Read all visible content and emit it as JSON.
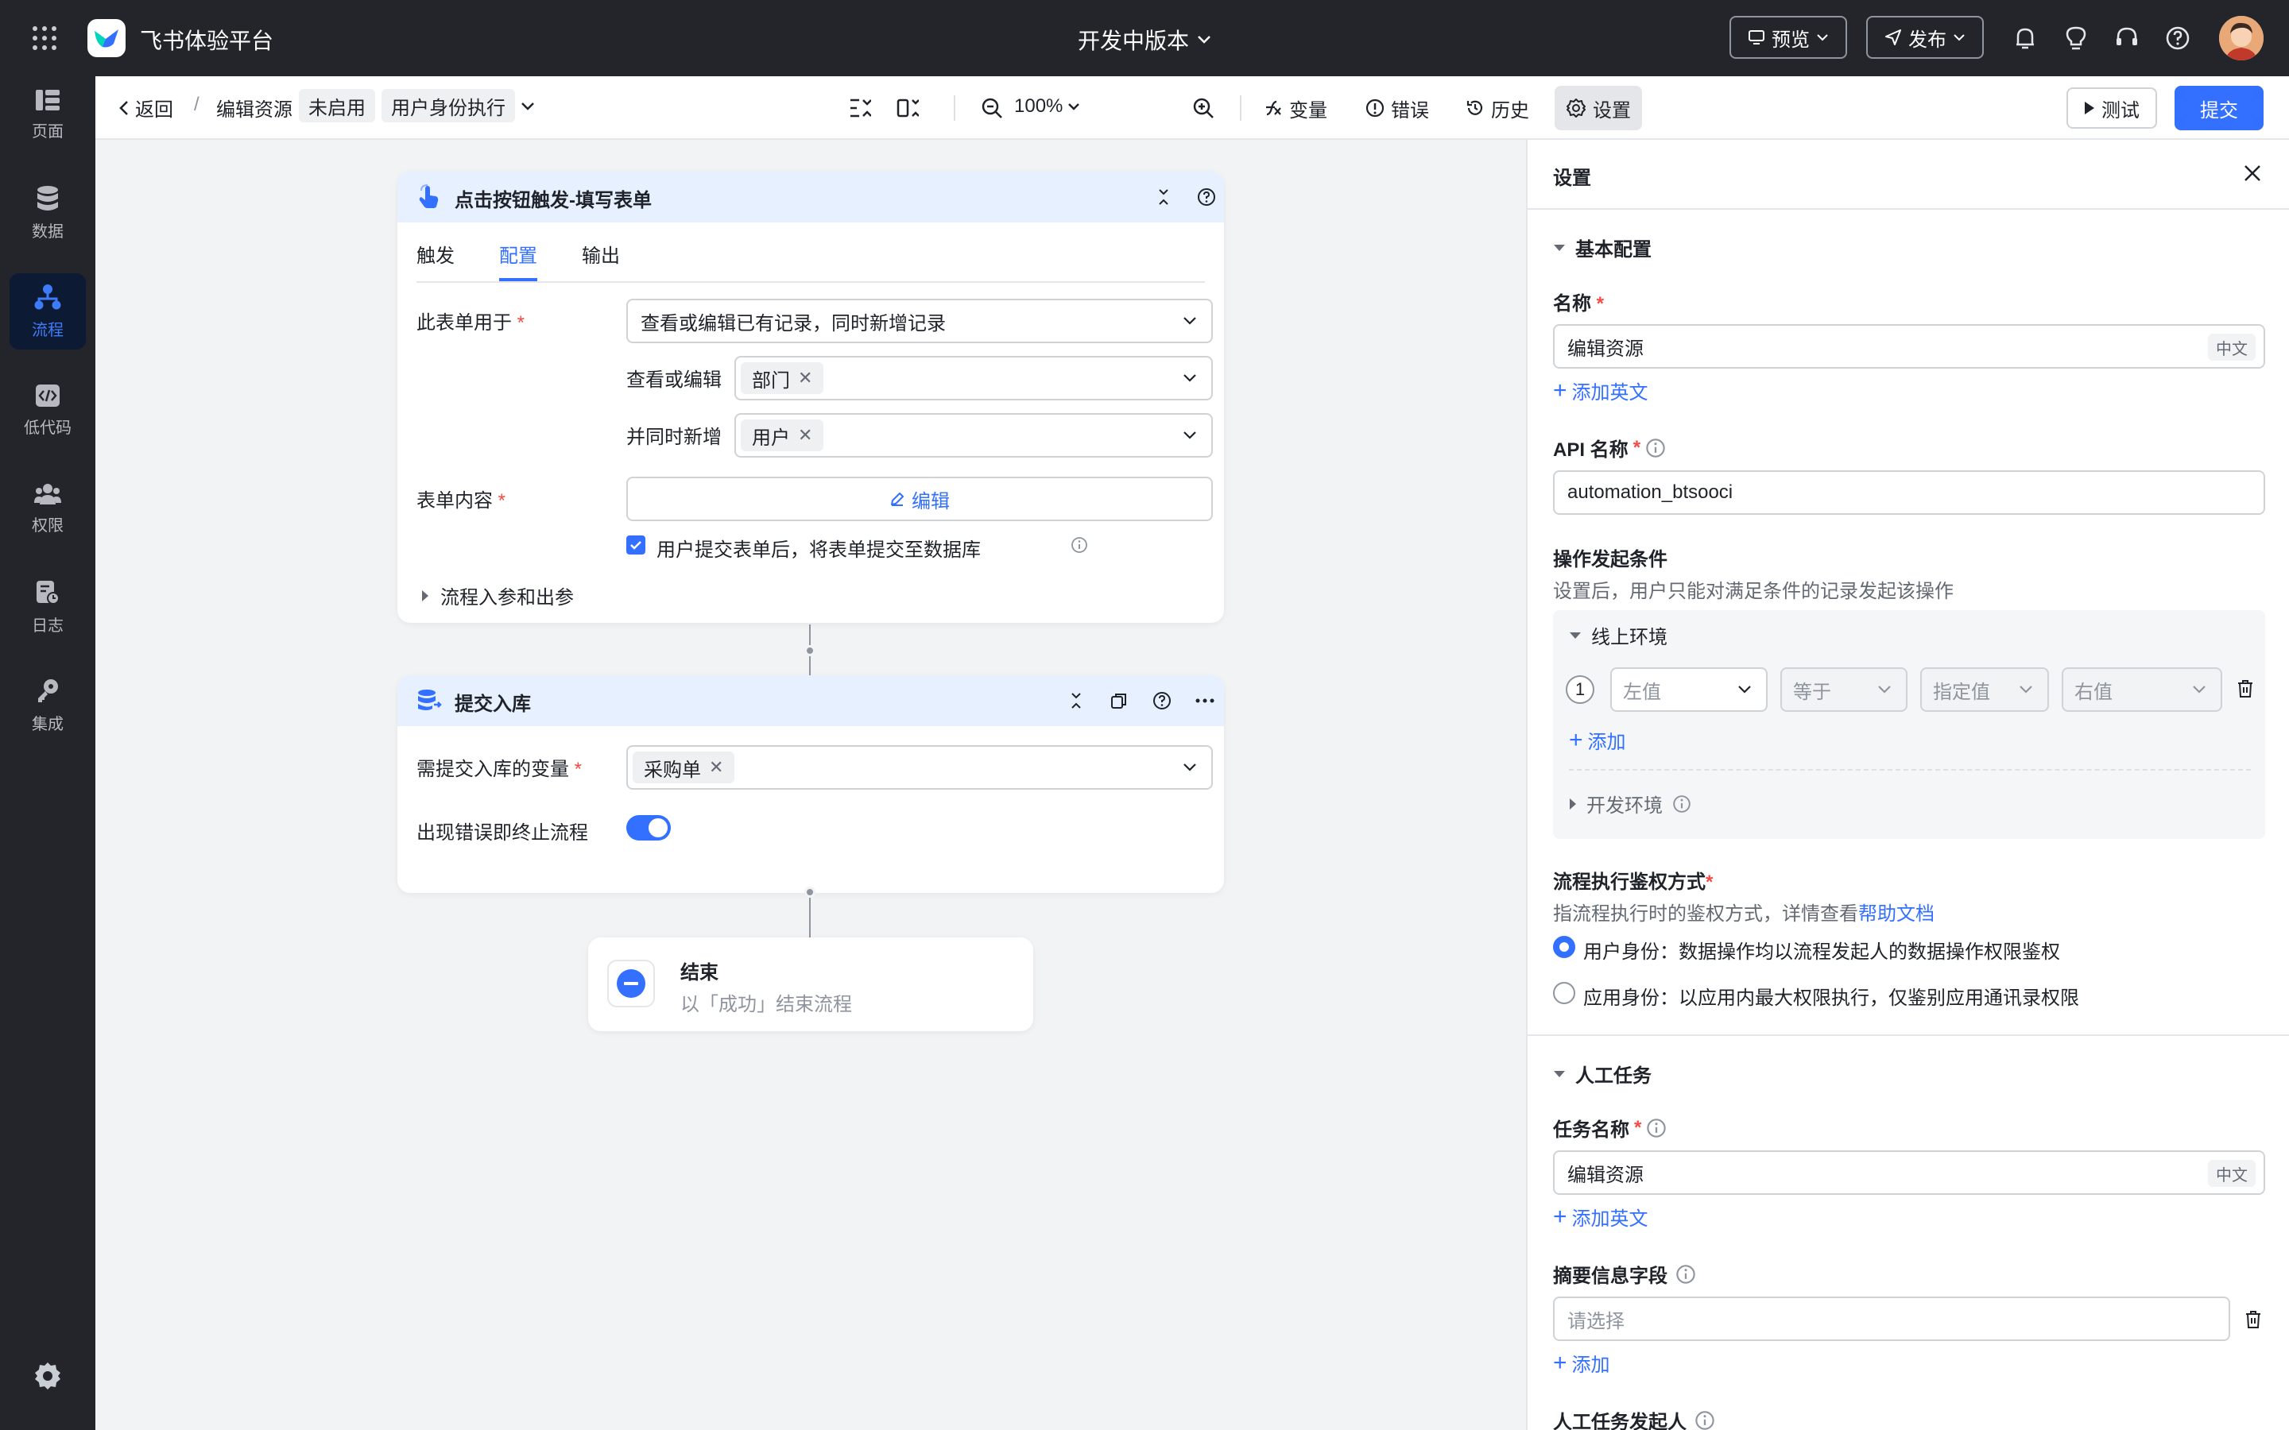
{
  "topbar": {
    "app_name": "飞书体验平台",
    "version_label": "开发中版本",
    "preview_label": "预览",
    "publish_label": "发布"
  },
  "sidebar": {
    "items": [
      {
        "label": "页面",
        "icon": "page-icon"
      },
      {
        "label": "数据",
        "icon": "database-icon"
      },
      {
        "label": "流程",
        "icon": "flow-icon",
        "active": true
      },
      {
        "label": "低代码",
        "icon": "code-icon"
      },
      {
        "label": "权限",
        "icon": "users-icon"
      },
      {
        "label": "日志",
        "icon": "log-icon"
      },
      {
        "label": "集成",
        "icon": "key-icon"
      }
    ]
  },
  "subbar": {
    "back_label": "返回",
    "separator": "/",
    "flow_name": "编辑资源",
    "status_tag": "未启用",
    "mode_tag": "用户身份执行",
    "zoom": "100%",
    "variables_label": "变量",
    "errors_label": "错误",
    "history_label": "历史",
    "settings_label": "设置",
    "test_label": "测试",
    "submit_label": "提交"
  },
  "card1": {
    "title": "点击按钮触发-填写表单",
    "tabs": [
      "触发",
      "配置",
      "输出"
    ],
    "active_tab": 1,
    "purpose_label": "此表单用于",
    "purpose_value": "查看或编辑已有记录，同时新增记录",
    "view_edit_label": "查看或编辑",
    "view_edit_tag": "部门",
    "also_add_label": "并同时新增",
    "also_add_tag": "用户",
    "form_content_label": "表单内容",
    "edit_button": "编辑",
    "checkbox_label": "用户提交表单后，将表单提交至数据库",
    "checkbox_checked": true,
    "params_label": "流程入参和出参"
  },
  "card2": {
    "title": "提交入库",
    "var_label": "需提交入库的变量",
    "var_tag": "采购单",
    "error_label": "出现错误即终止流程",
    "error_toggle": true
  },
  "end_node": {
    "title": "结束",
    "subtitle": "以「成功」结束流程"
  },
  "panel": {
    "title": "设置",
    "basic_section": "基本配置",
    "name_label": "名称",
    "name_value": "编辑资源",
    "lang_badge": "中文",
    "add_english": "添加英文",
    "api_label": "API 名称",
    "api_value": "automation_btsooci",
    "trigger_cond_label": "操作发起条件",
    "trigger_cond_desc": "设置后，用户只能对满足条件的记录发起该操作",
    "online_env": "线上环境",
    "cond_index": "1",
    "left_placeholder": "左值",
    "op_placeholder": "等于",
    "type_placeholder": "指定值",
    "right_placeholder": "右值",
    "add_label": "添加",
    "dev_env": "开发环境",
    "auth_label": "流程执行鉴权方式",
    "auth_desc": "指流程执行时的鉴权方式，详情查看",
    "help_doc": "帮助文档",
    "auth_option_user": "用户身份：数据操作均以流程发起人的数据操作权限鉴权",
    "auth_option_app": "应用身份：以应用内最大权限执行，仅鉴别应用通讯录权限",
    "auth_selected": "user",
    "manual_section": "人工任务",
    "task_name_label": "任务名称",
    "task_name_value": "编辑资源",
    "summary_label": "摘要信息字段",
    "summary_placeholder": "请选择",
    "initiator_label": "人工任务发起人"
  },
  "colors": {
    "topbar_bg": "#23252b",
    "accent": "#3370ff",
    "card_header": "#e7f0ff"
  }
}
